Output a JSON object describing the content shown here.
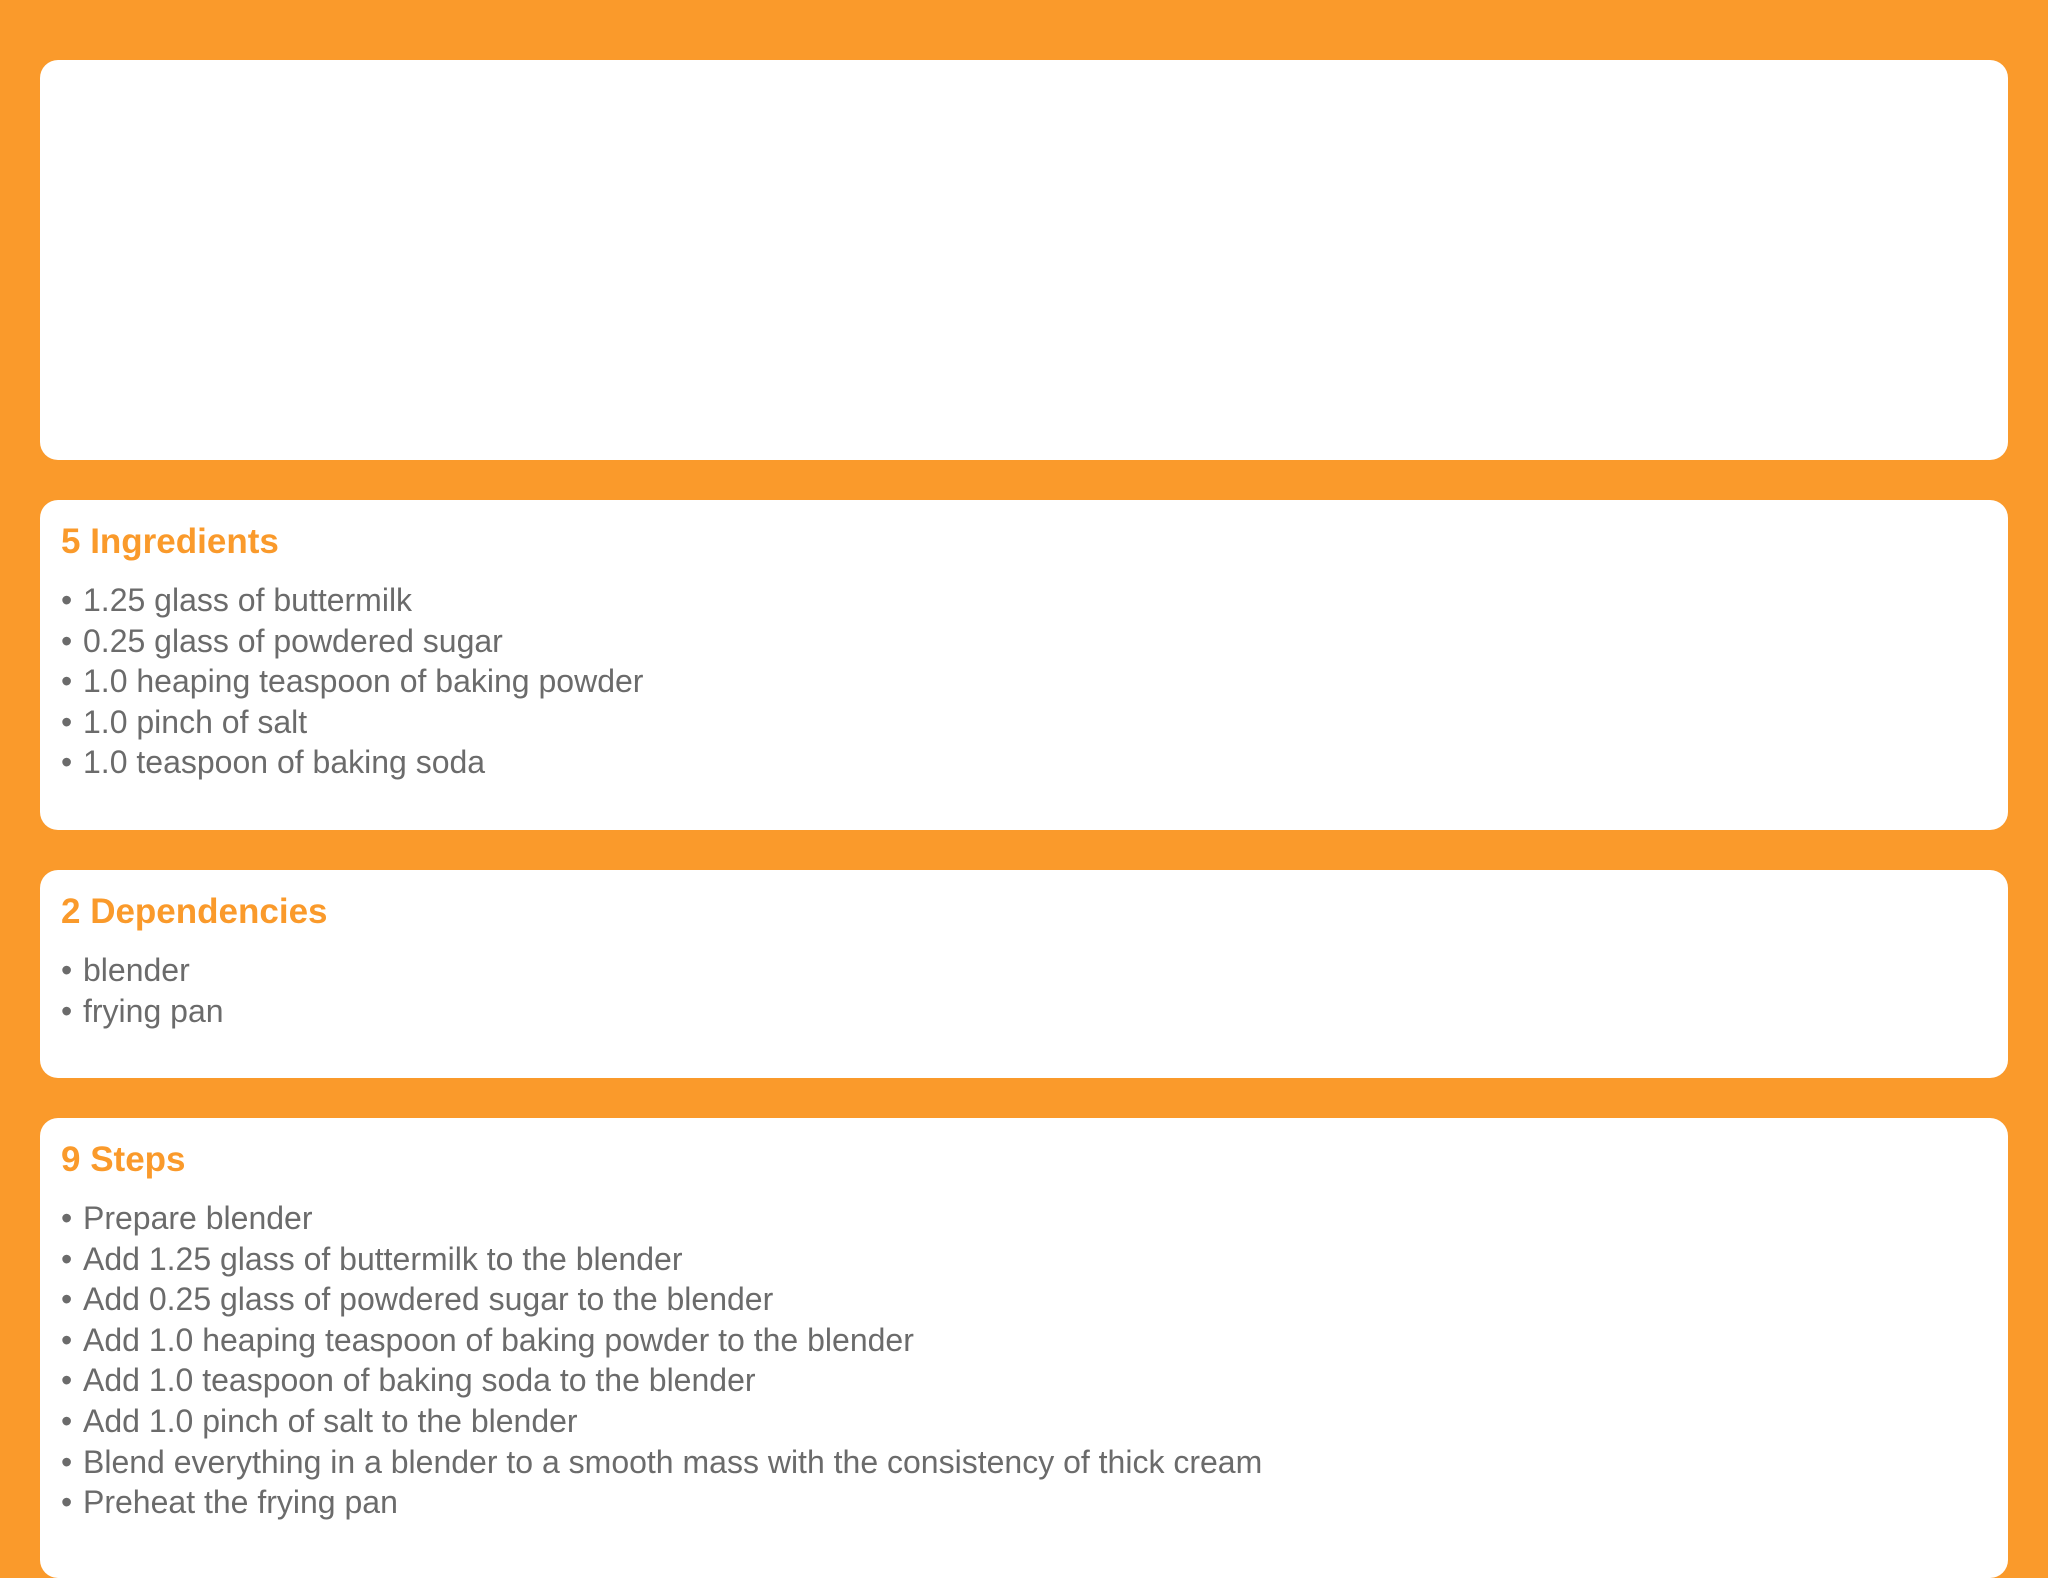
{
  "image_card": {},
  "ingredients": {
    "title": "5 Ingredients",
    "items": [
      "1.25 glass of buttermilk",
      "0.25 glass of powdered sugar",
      "1.0 heaping teaspoon of baking powder",
      "1.0 pinch of salt",
      "1.0 teaspoon of baking soda"
    ]
  },
  "dependencies": {
    "title": "2 Dependencies",
    "items": [
      "blender",
      "frying pan"
    ]
  },
  "steps": {
    "title": "9 Steps",
    "items": [
      "Prepare blender",
      "Add 1.25 glass of buttermilk to the blender",
      "Add 0.25 glass of powdered sugar to the blender",
      "Add 1.0 heaping teaspoon of baking powder to the blender",
      "Add 1.0 teaspoon of baking soda to the blender",
      "Add 1.0 pinch of salt to the blender",
      "Blend everything in a blender to a smooth mass with the consistency of thick cream",
      "Preheat the frying pan"
    ]
  },
  "colors": {
    "background": "#FA9A2B",
    "accent": "#FA9A2B",
    "card": "#FFFFFF",
    "text": "#6B6B6B"
  }
}
